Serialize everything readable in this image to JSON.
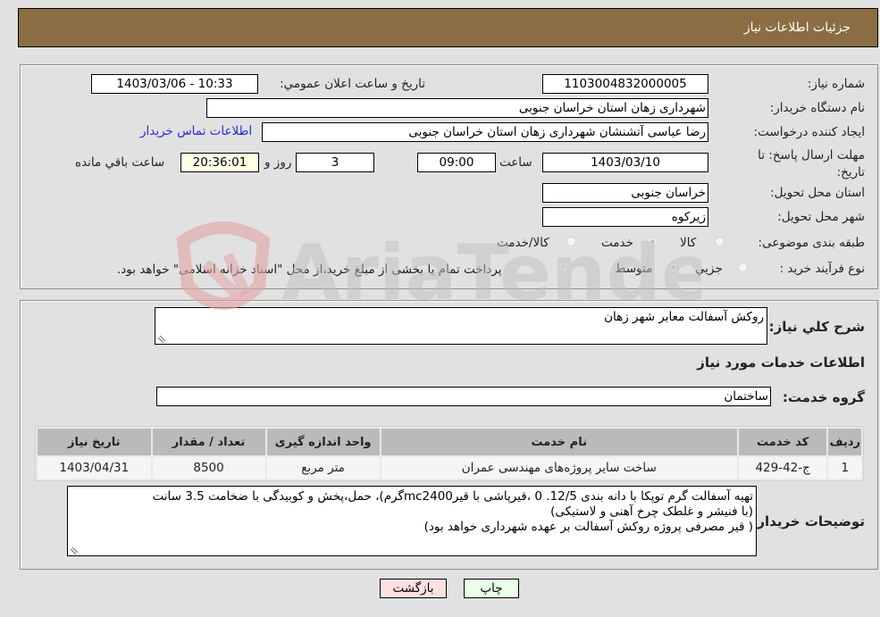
{
  "header": {
    "title": "جزئيات اطلاعات نياز"
  },
  "form": {
    "need_number": {
      "label": "شماره نياز:",
      "value": "1103004832000005"
    },
    "announce_datetime": {
      "label": "تاريخ و ساعت اعلان عمومي:",
      "value": "1403/03/06 - 10:33"
    },
    "buyer_org": {
      "label": "نام دستگاه خريدار:",
      "value": "شهرداری زهان استان خراسان جنوبی"
    },
    "requester": {
      "label": "ايجاد کننده درخواست:",
      "value": "رضا عباسی آتشنشان شهرداری زهان استان خراسان جنوبی"
    },
    "contact_link": "اطلاعات تماس خريدار",
    "deadline": {
      "label": "مهلت ارسال پاسخ: تا تاريخ:",
      "date": "1403/03/10",
      "time_label": "ساعت",
      "time": "09:00",
      "days": "3",
      "days_label": "روز و",
      "remaining": "20:36:01",
      "remaining_label": "ساعت باقي مانده"
    },
    "delivery_province": {
      "label": "استان محل تحويل:",
      "value": "خراسان جنوبی"
    },
    "delivery_city": {
      "label": "شهر محل تحويل:",
      "value": "زيرکوه"
    },
    "category": {
      "label": "طبقه بندی موضوعی:",
      "options": [
        "کالا",
        "خدمت",
        "کالا/خدمت"
      ],
      "selected": "خدمت"
    },
    "purchase_type": {
      "label": "نوع فرآيند خريد :",
      "options": [
        "جزيي",
        "متوسط"
      ],
      "selected": "متوسط",
      "treasury_checkbox_label": "پرداخت تمام يا بخشی از مبلغ خريد،از محل \"اسناد خزانه اسلامی\" خواهد بود."
    }
  },
  "details": {
    "summary_label": "شرح کلي نياز:",
    "summary_value": "روکش آسفالت معابر شهر زهان",
    "services_heading": "اطلاعات خدمات مورد نياز",
    "service_group_label": "گروه خدمت:",
    "service_group_value": "ساختمان",
    "table": {
      "headers": [
        "رديف",
        "کد خدمت",
        "نام خدمت",
        "واحد اندازه گيری",
        "تعداد / مقدار",
        "تاريخ نياز"
      ],
      "rows": [
        [
          "1",
          "ج-42-429",
          "ساخت ساير پروژه‌های مهندسی عمران",
          "متر مربع",
          "8500",
          "1403/04/31"
        ]
      ]
    },
    "buyer_notes_label": "توضيحات خريدار:",
    "buyer_notes_lines": [
      "تهيه آسفالت گرم توپکا با دانه بندی 12/5. 0 ،قيرپاشی با قيرmc2400گرم)، حمل،پخش و کوبيدگی  با ضخامت 3.5 سانت",
      "(با فنيشر و غلطک چرخ آهنی و لاستيکی)",
      "( قير مصرفی پروژه روکش آسفالت بر عهده شهرداری خواهد بود)"
    ]
  },
  "buttons": {
    "print": "چاپ",
    "back": "بازگشت"
  },
  "colors": {
    "header": "#8b6d43",
    "print_bg": "#eaffea",
    "back_bg": "#ffe0e0",
    "link": "#2828d8"
  },
  "watermark": {
    "text": "AriaTender.neT"
  }
}
